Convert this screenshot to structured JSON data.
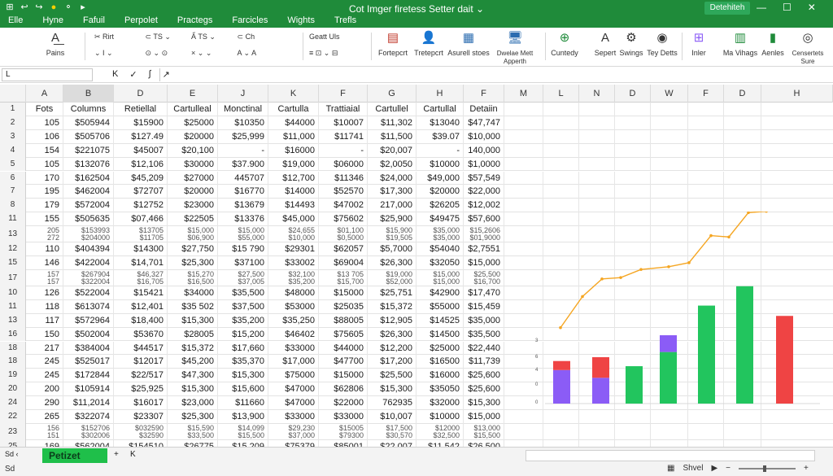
{
  "titlebar": {
    "title": "Cot Imger firetess Setter dait ⌄",
    "share_label": "Detehiteh",
    "qat": [
      "⊞",
      "↩",
      "↪",
      "●",
      "⚬",
      "▸"
    ],
    "window_controls": [
      "—",
      "☐",
      "✕"
    ]
  },
  "tabs": [
    "Elle",
    "Hyne",
    "Fafuil",
    "Perpolet",
    "Practegs",
    "Farcicles",
    "Wights",
    "Trefls"
  ],
  "ribbon": {
    "paste_label": "Pains",
    "font_group": [
      "✂ Rirt",
      "⊂ TS ⌄",
      "A̋ TS ⌄",
      "⊂ Ch"
    ],
    "font_row2": [
      "⌄ I ⌄",
      "⊙ ⌄ ⊙",
      "× ⌄ ⌄",
      "A ⌄ A"
    ],
    "align_label": "Geatt Uls",
    "buttons": [
      {
        "label": "Fortepcrt",
        "icon": "format-icon"
      },
      {
        "label": "Tretepcrt",
        "icon": "person-icon"
      },
      {
        "label": "Asurell stoes",
        "icon": "table-icon"
      },
      {
        "label": "Dwelae Mett Apperth",
        "icon": "monitor-icon"
      },
      {
        "label": "Cuntedy",
        "icon": "styles-icon"
      },
      {
        "label": "Sepert",
        "icon": "sort-icon"
      },
      {
        "label": "Swings",
        "icon": "gear-icon"
      },
      {
        "label": "Tey Detts",
        "icon": "dots-icon"
      },
      {
        "label": "Inler",
        "icon": "insert-icon"
      },
      {
        "label": "Ma Vihags",
        "icon": "chart-icon"
      },
      {
        "label": "Aenles",
        "icon": "bars-icon"
      },
      {
        "label": "Censertets Sure",
        "icon": "search-icon"
      }
    ]
  },
  "formula_bar": {
    "name_box": "L",
    "controls": [
      "K",
      "✓",
      "∫",
      "↗"
    ]
  },
  "columns": [
    "A",
    "B",
    "D",
    "E",
    "J",
    "K",
    "F",
    "G",
    "H",
    "F",
    "M",
    "L",
    "N",
    "D",
    "W",
    "F",
    "D",
    "H"
  ],
  "header_row": {
    "num": "1",
    "cells": [
      "Fots",
      "Columns",
      "Retiellal",
      "Cartulleal",
      "Monctinal",
      "Cartulla",
      "Trattiaial",
      "Cartullel",
      "Cartullal",
      "Detaiin"
    ]
  },
  "rows": [
    {
      "num": "2",
      "cells": [
        "105",
        "$505944",
        "$15900",
        "$25000",
        "$10350",
        "$44000",
        "$10007",
        "$11,302",
        "$13040",
        "$47,747"
      ]
    },
    {
      "num": "3",
      "cells": [
        "106",
        "$505706",
        "$127.49",
        "$20000",
        "$25,999",
        "$11,000",
        "$11741",
        "$11,500",
        "$39.07",
        "$10,000"
      ]
    },
    {
      "num": "4",
      "cells": [
        "154",
        "$221075",
        "$45007",
        "$20,100",
        "-",
        "$16000",
        "-",
        "$20,007",
        "-",
        "140,000"
      ]
    },
    {
      "num": "5",
      "cells": [
        "105",
        "$132076",
        "$12,106",
        "$30000",
        "$37.900",
        "$19,000",
        "$06000",
        "$2,0050",
        "$10000",
        "$1,0000"
      ]
    },
    {
      "num": "6",
      "cells": [
        "170",
        "$162504",
        "$45,209",
        "$27000",
        "445707",
        "$12,700",
        "$11346",
        "$24,000",
        "$49,000",
        "$57,549"
      ]
    },
    {
      "num": "7",
      "cells": [
        "195",
        "$462004",
        "$72707",
        "$20000",
        "$16770",
        "$14000",
        "$52570",
        "$17,300",
        "$20000",
        "$22,000"
      ]
    },
    {
      "num": "8",
      "cells": [
        "179",
        "$572004",
        "$12752",
        "$23000",
        "$13679",
        "$14493",
        "$47002",
        "217,000",
        "$26205",
        "$12,002"
      ]
    },
    {
      "num": "11",
      "cells": [
        "155",
        "$505635",
        "$07,466",
        "$22505",
        "$13376",
        "$45,000",
        "$75602",
        "$25,900",
        "$49475",
        "$57,600"
      ]
    },
    {
      "num": "13",
      "thin": true,
      "cells": [
        "205 / 272",
        "$153993 / $204000",
        "$13705 / $11705",
        "$15,000 / $06,900",
        "$15,000 / $55,000",
        "$24,655 / $10,000",
        "$01,100 / $0,5000",
        "$15,900 / $19,505",
        "$35,000 / $35,000",
        "$15,2606 / $01,9000"
      ]
    },
    {
      "num": "12",
      "cells": [
        "110",
        "$404394",
        "$14300",
        "$27,750",
        "$15 790",
        "$29301",
        "$62057",
        "$5,7000",
        "$54040",
        "$2,7551"
      ]
    },
    {
      "num": "15",
      "cells": [
        "146",
        "$422004",
        "$14,701",
        "$25,300",
        "$37100",
        "$33002",
        "$69004",
        "$26,300",
        "$32050",
        "$15,000"
      ]
    },
    {
      "num": "17",
      "thin": true,
      "cells": [
        "157 / 157",
        "$267904 / $322004",
        "$46,327 / $16,705",
        "$15,270 / $16,500",
        "$27,500 / $37,005",
        "$32,100 / $35,200",
        "$13 705 / $15,700",
        "$19,000 / $52,000",
        "$15,000 / $15,000",
        "$25,500 / $16,700"
      ]
    },
    {
      "num": "10",
      "cells": [
        "126",
        "$522004",
        "$15421",
        "$34000",
        "$35,500",
        "$48000",
        "$15000",
        "$25,751",
        "$42900",
        "$17,470"
      ]
    },
    {
      "num": "11",
      "cells": [
        "118",
        "$613074",
        "$12,401",
        "$35 502",
        "$37,500",
        "$53000",
        "$25035",
        "$15,372",
        "$55000",
        "$15,459"
      ]
    },
    {
      "num": "13",
      "cells": [
        "117",
        "$572964",
        "$18,400",
        "$15,300",
        "$35,200",
        "$35,250",
        "$88005",
        "$12,905",
        "$14525",
        "$35,000"
      ]
    },
    {
      "num": "16",
      "cells": [
        "150",
        "$502004",
        "$53670",
        "$28005",
        "$15,200",
        "$46402",
        "$75605",
        "$26,300",
        "$14500",
        "$35,500"
      ]
    },
    {
      "num": "18",
      "cells": [
        "217",
        "$384004",
        "$44517",
        "$15,372",
        "$17,660",
        "$33000",
        "$44000",
        "$12,200",
        "$25000",
        "$22,440"
      ]
    },
    {
      "num": "18",
      "cells": [
        "245",
        "$525017",
        "$12017",
        "$45,200",
        "$35,370",
        "$17,000",
        "$47700",
        "$17,200",
        "$16500",
        "$11,739"
      ]
    },
    {
      "num": "19",
      "cells": [
        "245",
        "$172844",
        "$22/517",
        "$47,300",
        "$15,300",
        "$75000",
        "$15000",
        "$25,500",
        "$16000",
        "$25,600"
      ]
    },
    {
      "num": "20",
      "cells": [
        "200",
        "$105914",
        "$25,925",
        "$15,300",
        "$15,600",
        "$47000",
        "$62806",
        "$15,300",
        "$35050",
        "$25,600"
      ]
    },
    {
      "num": "24",
      "cells": [
        "290",
        "$11,2014",
        "$16017",
        "$23,000",
        "$11660",
        "$47000",
        "$22000",
        "762935",
        "$32000",
        "$15,300"
      ]
    },
    {
      "num": "22",
      "cells": [
        "265",
        "$322074",
        "$23307",
        "$25,300",
        "$13,900",
        "$33000",
        "$33000",
        "$10,007",
        "$10000",
        "$15,000"
      ]
    },
    {
      "num": "23",
      "thin": true,
      "cells": [
        "156 / 151",
        "$152706 / $302006",
        "$032590 / $32590",
        "$15,590 / $33,500",
        "$14,099 / $15,500",
        "$29,230 / $37,000",
        "$15005 / $79300",
        "$17,500 / $30,570",
        "$12000 / $32,500",
        "$13,000 / $15,500"
      ]
    },
    {
      "num": "25",
      "cells": [
        "169",
        "$562004",
        "$154510",
        "$26775",
        "$15,209",
        "$75379",
        "$85001",
        "$22,007",
        "$11,542",
        "$26,500"
      ]
    }
  ],
  "chart_data": {
    "type": "bar",
    "y_ticks": [
      "3",
      "6",
      "4",
      "0",
      "0"
    ],
    "bars": [
      {
        "values": [
          2.6,
          0.7
        ],
        "colors": [
          "#8b5cf6",
          "#ef4444"
        ]
      },
      {
        "values": [
          2.0,
          1.6
        ],
        "colors": [
          "#8b5cf6",
          "#ef4444"
        ]
      },
      {
        "values": [
          2.9
        ],
        "colors": [
          "#22c55e"
        ]
      },
      {
        "values": [
          4.0,
          1.3
        ],
        "colors": [
          "#22c55e",
          "#8b5cf6"
        ]
      },
      {
        "values": [
          7.6
        ],
        "colors": [
          "#22c55e"
        ]
      },
      {
        "values": [
          9.1
        ],
        "colors": [
          "#22c55e"
        ]
      },
      {
        "values": [
          6.8
        ],
        "colors": [
          "#ef4444"
        ]
      }
    ],
    "line": {
      "color": "#f5a623",
      "values": [
        2.0,
        4.3,
        5.6,
        5.7,
        6.3,
        6.5,
        6.8,
        8.8,
        8.7,
        10.5,
        10.6,
        10.9,
        11.7
      ]
    },
    "ylim": [
      0,
      13
    ]
  },
  "sheet": {
    "nav": "Sd ‹",
    "tab_label": "Petizet",
    "add": "+",
    "scroll": "K"
  },
  "status": {
    "ready": "Sd",
    "view": "Shvel",
    "cursor": "▶"
  }
}
